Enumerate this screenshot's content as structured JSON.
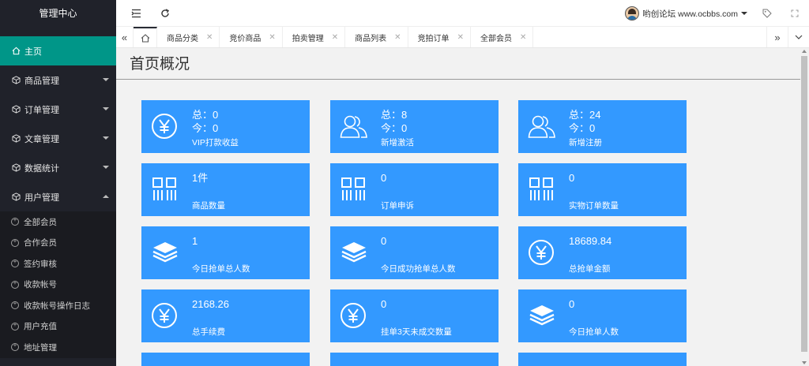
{
  "sidebar": {
    "logo": "管理中心",
    "menu": [
      {
        "label": "主页",
        "icon": "home-icon"
      },
      {
        "label": "商品管理",
        "icon": "cube-icon"
      },
      {
        "label": "订单管理",
        "icon": "cube-icon"
      },
      {
        "label": "文章管理",
        "icon": "cube-icon"
      },
      {
        "label": "数据统计",
        "icon": "cube-icon"
      },
      {
        "label": "用户管理",
        "icon": "cube-icon"
      }
    ],
    "submenu": [
      "全部会员",
      "合作会员",
      "签约审核",
      "收款帐号",
      "收款帐号操作日志",
      "用户充值",
      "地址管理"
    ]
  },
  "header": {
    "menu_icon": "indent-icon",
    "refresh_icon": "refresh-icon",
    "user": "哟创论坛 www.ocbbs.com",
    "tag_icon": "tag-icon",
    "fullscreen_icon": "fullscreen-icon"
  },
  "tabs": [
    "商品分类",
    "竞价商品",
    "拍卖管理",
    "商品列表",
    "竞拍订单",
    "全部会员"
  ],
  "page_title": "首页概况",
  "cards": [
    {
      "icon": "yuan-icon",
      "line1": "总：0",
      "line2": "今：0",
      "label": "VIP打款收益"
    },
    {
      "icon": "users-icon",
      "line1": "总：8",
      "line2": "今：0",
      "label": "新增激活"
    },
    {
      "icon": "users-icon",
      "line1": "总：24",
      "line2": "今：0",
      "label": "新增注册"
    },
    {
      "icon": "barcode-icon",
      "line1": "1件",
      "line2": "",
      "label": "商品数量"
    },
    {
      "icon": "barcode-icon",
      "line1": "0",
      "line2": "",
      "label": "订单申诉"
    },
    {
      "icon": "barcode-icon",
      "line1": "0",
      "line2": "",
      "label": "实物订单数量"
    },
    {
      "icon": "layers-icon",
      "line1": "1",
      "line2": "",
      "label": "今日抢单总人数"
    },
    {
      "icon": "layers-icon",
      "line1": "0",
      "line2": "",
      "label": "今日成功抢单总人数"
    },
    {
      "icon": "yuan-icon",
      "line1": "18689.84",
      "line2": "",
      "label": "总抢单金额"
    },
    {
      "icon": "yuan-icon",
      "line1": "2168.26",
      "line2": "",
      "label": "总手续费"
    },
    {
      "icon": "yuan-icon",
      "line1": "0",
      "line2": "",
      "label": "挂单3天未成交数量"
    },
    {
      "icon": "layers-icon",
      "line1": "0",
      "line2": "",
      "label": "今日抢单人数"
    }
  ],
  "colors": {
    "sidebar": "#20222a",
    "active": "#009688",
    "card": "#3399ff"
  }
}
